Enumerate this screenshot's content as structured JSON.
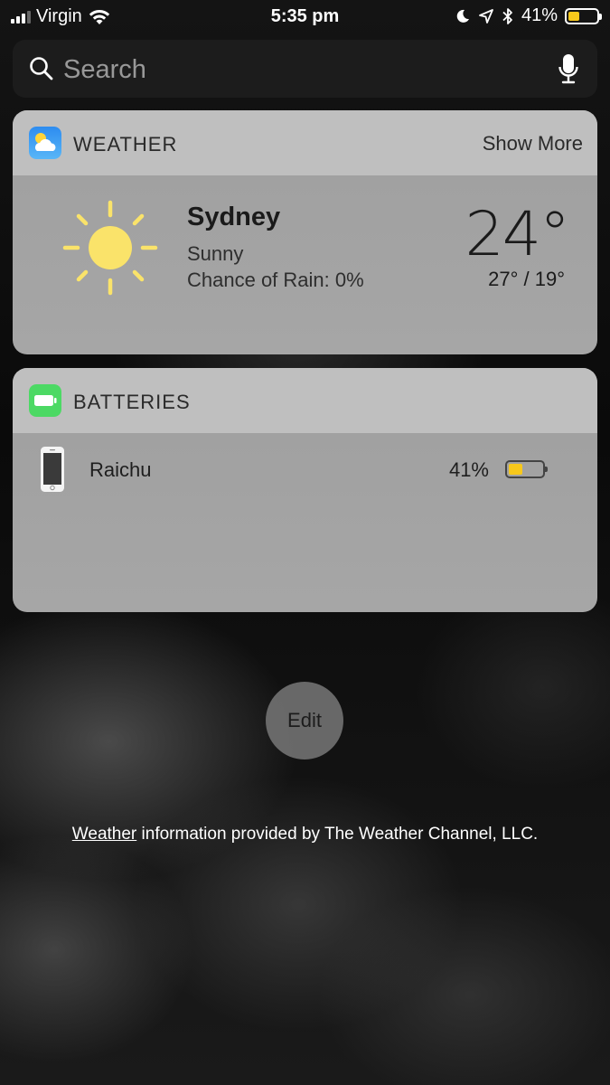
{
  "status_bar": {
    "carrier": "Virgin",
    "time": "5:35 pm",
    "battery_percent_label": "41%",
    "battery_level": 0.41,
    "battery_color": "#f7c81b"
  },
  "search": {
    "placeholder": "Search",
    "value": ""
  },
  "weather_widget": {
    "title": "WEATHER",
    "show_more_label": "Show More",
    "city": "Sydney",
    "condition": "Sunny",
    "rain_chance": "Chance of Rain: 0%",
    "temperature": "24°",
    "high_low": "27° / 19°",
    "icon": "sun-icon"
  },
  "batteries_widget": {
    "title": "BATTERIES",
    "devices": [
      {
        "name": "Raichu",
        "percent_label": "41%",
        "level": 0.41,
        "icon": "iphone-icon"
      }
    ]
  },
  "edit_button": {
    "label": "Edit"
  },
  "attribution": {
    "link_text": "Weather",
    "rest_text": " information provided by The Weather Channel, LLC."
  }
}
